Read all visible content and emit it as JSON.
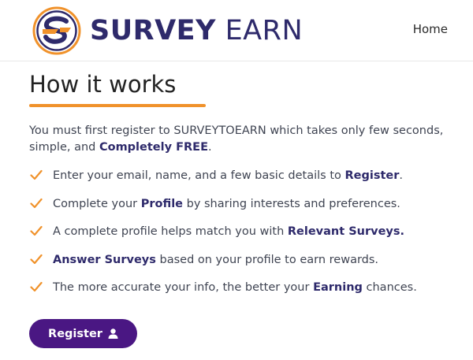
{
  "header": {
    "brand_part1": "SURVEY",
    "brand_part2": "EARN",
    "nav_home": "Home"
  },
  "main": {
    "title": "How it works",
    "intro_before": "You must first register to SURVEYTOEARN which takes only few seconds, simple, and ",
    "intro_highlight": "Completely FREE",
    "intro_after": ".",
    "steps": [
      {
        "before": "Enter your email, name, and a few basic details to ",
        "highlight": "Register",
        "after": "."
      },
      {
        "before": "Complete your ",
        "highlight": "Profile",
        "after": " by sharing interests and preferences."
      },
      {
        "before": "A complete profile helps match you with ",
        "highlight": "Relevant Surveys.",
        "after": ""
      },
      {
        "before": "",
        "highlight": "Answer Surveys",
        "after": " based on your profile to earn rewards."
      },
      {
        "before": "The more accurate your info, the better your ",
        "highlight": "Earning",
        "after": " chances."
      }
    ],
    "register_label": "Register"
  },
  "colors": {
    "brand_navy": "#2e2a6b",
    "accent_orange": "#f0922b",
    "button_purple": "#4a1783"
  },
  "icons": {
    "logo": "survey-earn-logo-icon",
    "check": "check-icon",
    "user": "user-icon"
  }
}
